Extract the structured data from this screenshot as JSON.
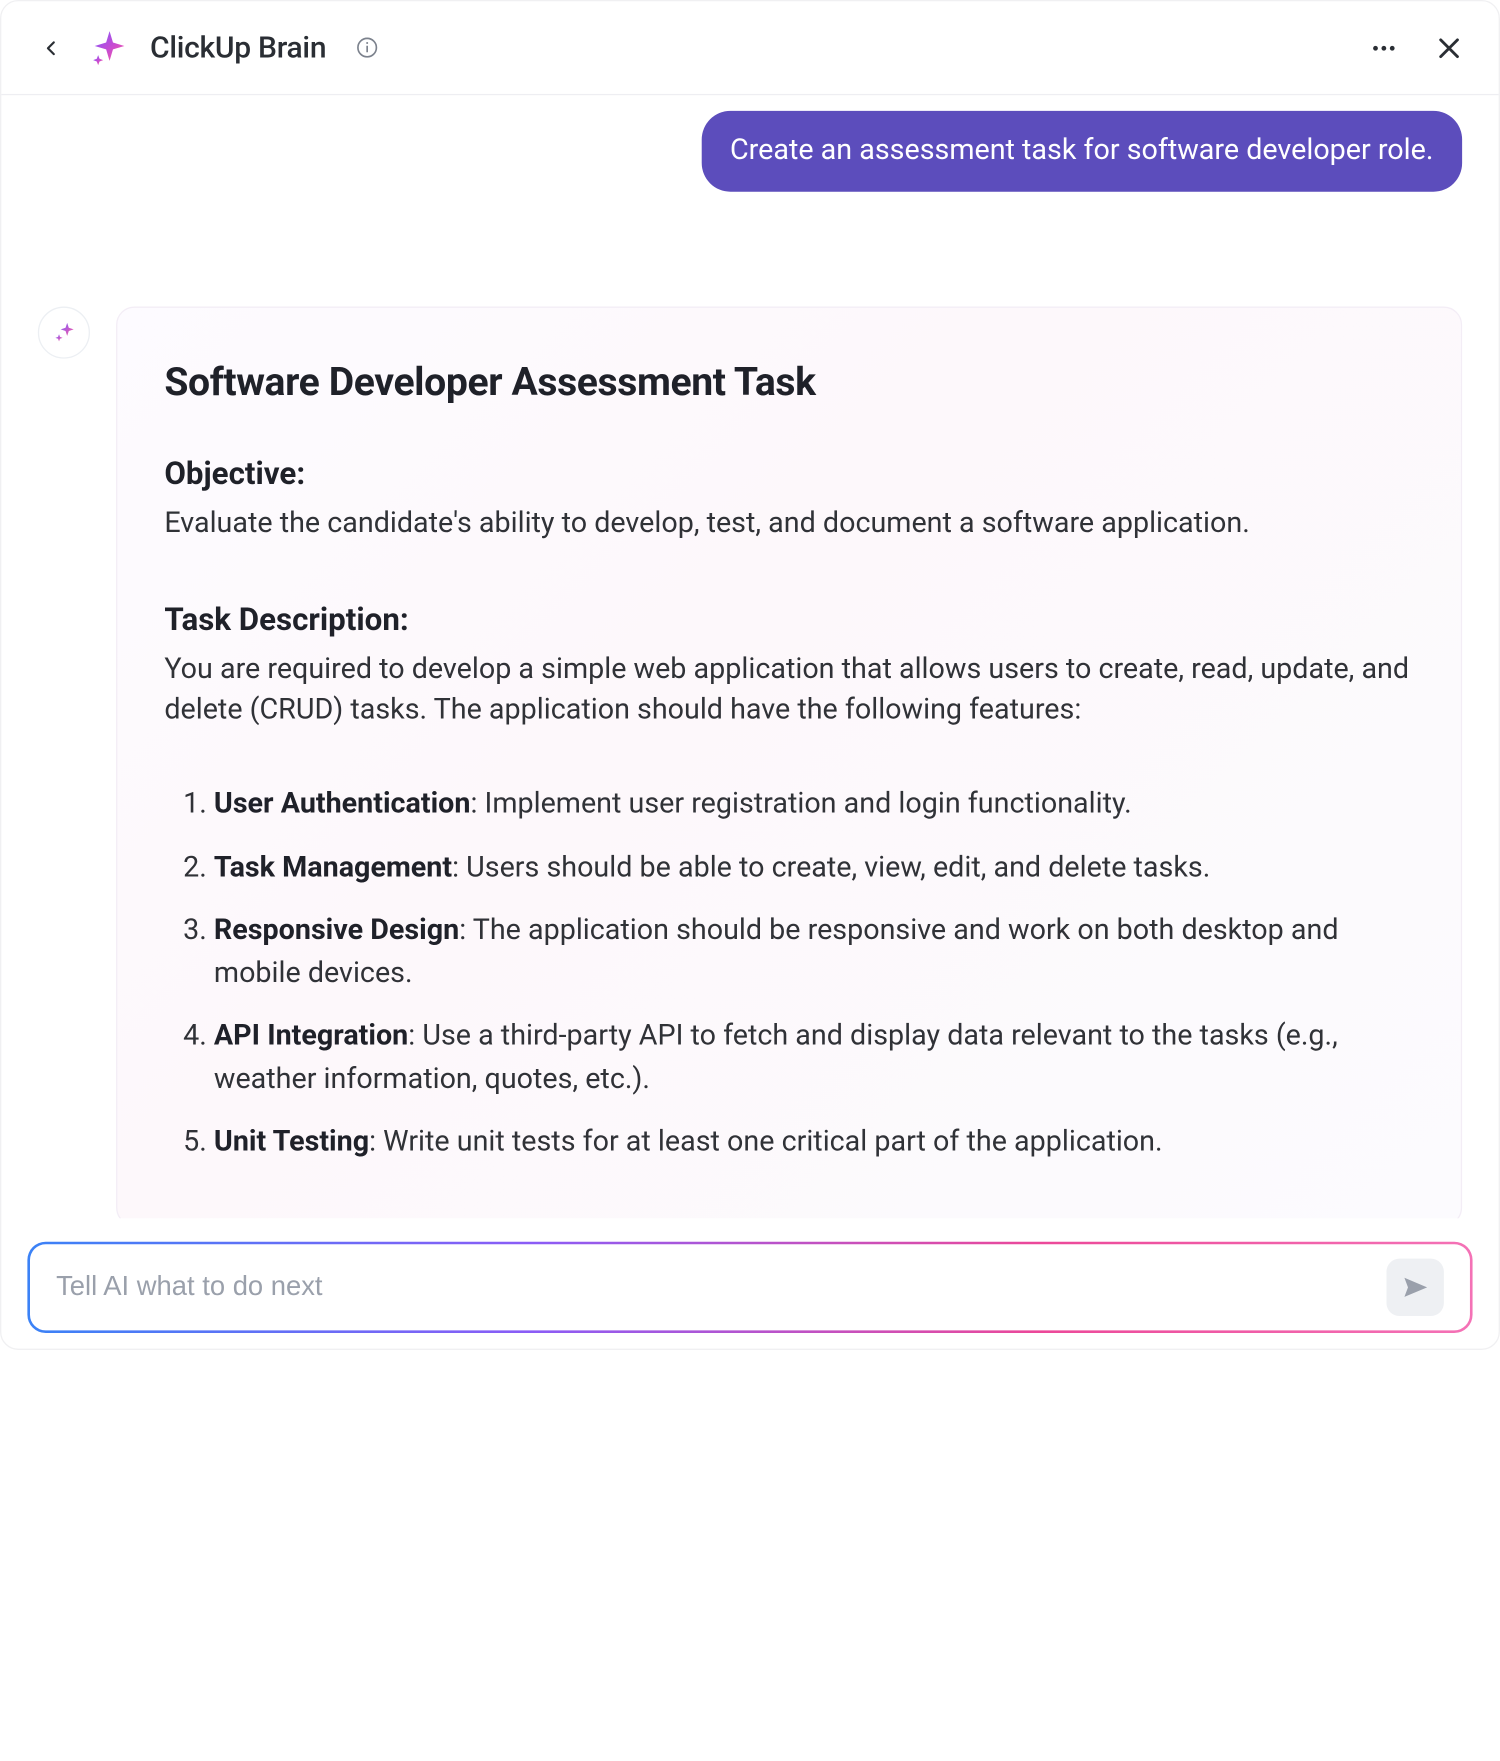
{
  "header": {
    "title": "ClickUp Brain"
  },
  "conversation": {
    "user_message": "Create an assessment task for software developer role."
  },
  "assistant": {
    "title": "Software Developer Assessment Task",
    "objective_heading": "Objective:",
    "objective_body": "Evaluate the candidate's ability to develop, test, and document a software application.",
    "task_heading": "Task Description:",
    "task_body": "You are required to develop a simple web application that allows users to create, read, update, and delete (CRUD) tasks. The application should have the following features:",
    "features": [
      {
        "label": "User Authentication",
        "text": ": Implement user registration and login functionality."
      },
      {
        "label": "Task Management",
        "text": ": Users should be able to create, view, edit, and delete tasks."
      },
      {
        "label": "Responsive Design",
        "text": ": The application should be responsive and work on both desktop and mobile devices."
      },
      {
        "label": "API Integration",
        "text": ": Use a third-party API to fetch and display data relevant to the tasks (e.g., weather information, quotes, etc.)."
      },
      {
        "label": "Unit Testing",
        "text": ": Write unit tests for at least one critical part of the application."
      }
    ]
  },
  "composer": {
    "placeholder": "Tell AI what to do next"
  }
}
